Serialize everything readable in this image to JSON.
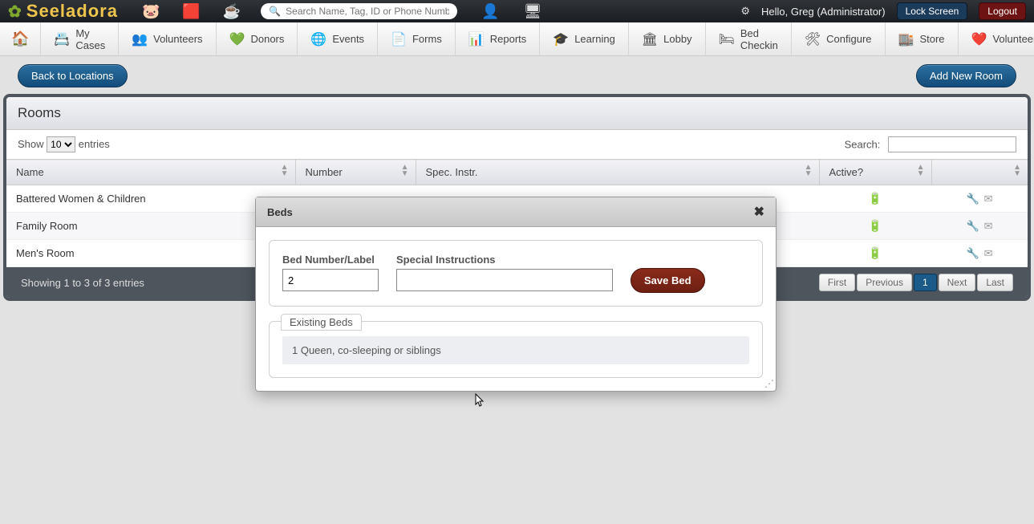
{
  "topbar": {
    "app_name": "Seeladora",
    "search_placeholder": "Search Name, Tag, ID or Phone Numb",
    "greeting": "Hello, Greg (Administrator)",
    "lock_label": "Lock Screen",
    "logout_label": "Logout"
  },
  "nav": {
    "items": [
      {
        "label": "My Cases",
        "icon": "📇"
      },
      {
        "label": "Volunteers",
        "icon": "👥"
      },
      {
        "label": "Donors",
        "icon": "💚"
      },
      {
        "label": "Events",
        "icon": "🌐"
      },
      {
        "label": "Forms",
        "icon": "📄"
      },
      {
        "label": "Reports",
        "icon": "📊"
      },
      {
        "label": "Learning",
        "icon": "🎓"
      },
      {
        "label": "Lobby",
        "icon": "🏛"
      },
      {
        "label": "Bed Checkin",
        "icon": "🛏"
      },
      {
        "label": "Configure",
        "icon": "🛠"
      },
      {
        "label": "Store",
        "icon": "🏬"
      },
      {
        "label": "Volunteer",
        "icon": "❤️"
      }
    ]
  },
  "actions": {
    "back": "Back to Locations",
    "add": "Add New Room"
  },
  "panel": {
    "title": "Rooms",
    "show_prefix": "Show",
    "show_value": "10",
    "show_suffix": "entries",
    "search_label": "Search:",
    "columns": {
      "name": "Name",
      "number": "Number",
      "spec": "Spec. Instr.",
      "active": "Active?",
      "actions": ""
    },
    "rows": [
      {
        "name": "Battered Women & Children"
      },
      {
        "name": "Family Room"
      },
      {
        "name": "Men's Room"
      }
    ],
    "footer_info": "Showing 1 to 3 of 3 entries",
    "pager": {
      "first": "First",
      "prev": "Previous",
      "page": "1",
      "next": "Next",
      "last": "Last"
    }
  },
  "dialog": {
    "title": "Beds",
    "bed_label": "Bed Number/Label",
    "bed_value": "2",
    "spec_label": "Special Instructions",
    "spec_value": "",
    "save_label": "Save Bed",
    "existing_title": "Existing Beds",
    "existing_row": "1 Queen, co-sleeping or siblings"
  }
}
